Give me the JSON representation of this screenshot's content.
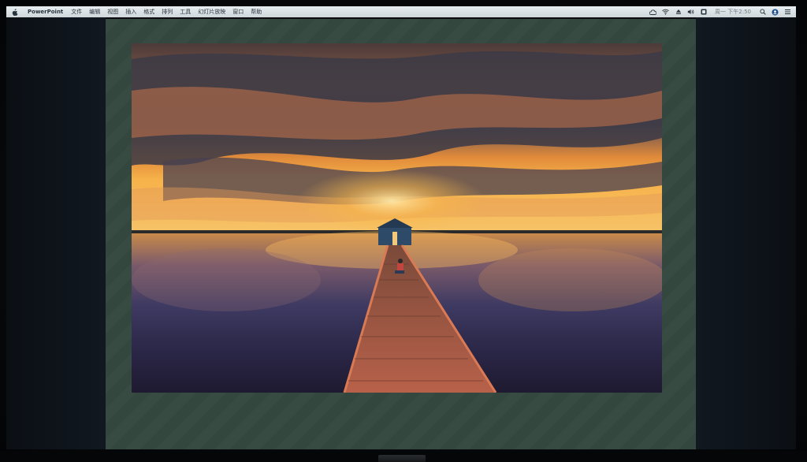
{
  "menubar": {
    "apple_icon": "apple-logo-icon",
    "app_name": "PowerPoint",
    "items": [
      "文件",
      "编辑",
      "视图",
      "插入",
      "格式",
      "排列",
      "工具",
      "幻灯片放映",
      "窗口",
      "帮助"
    ],
    "status_icons": [
      "cloud-sync-icon",
      "wifi-icon",
      "eject-icon",
      "volume-icon",
      "input-method-icon",
      "search-icon",
      "user-icon",
      "list-icon"
    ],
    "clock": "周一 下午2:50"
  },
  "slide": {
    "photo": "sunset-boathouse-jetty-photo"
  },
  "colors": {
    "menubar": "#dfe6ea",
    "stage": "#33473f",
    "sky_orange": "#f29a3c",
    "cloud_dark": "#3b3a45",
    "water_purple": "#3a3354",
    "jetty": "#b8614a"
  }
}
